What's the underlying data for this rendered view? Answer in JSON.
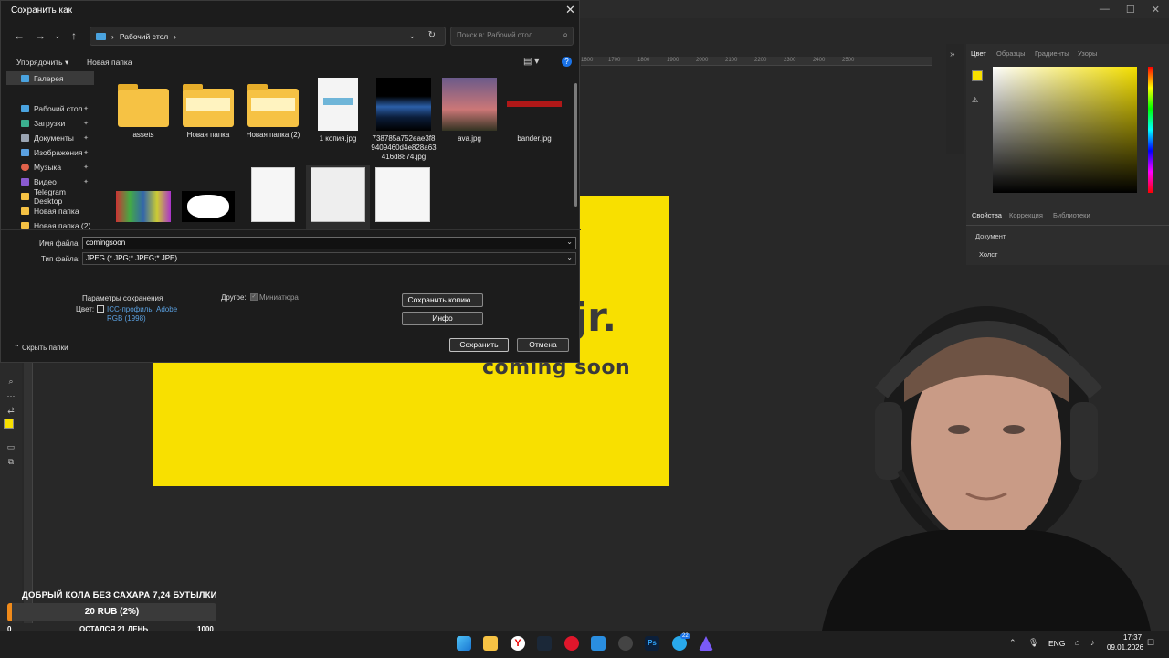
{
  "dialog": {
    "title": "Сохранить как",
    "address": "Рабочий стол",
    "search_placeholder": "Поиск в: Рабочий стол",
    "organize": "Упорядочить ▾",
    "new_folder": "Новая папка",
    "sidebar": [
      {
        "label": "Галерея",
        "color": "#4aa3df",
        "pinned": false
      },
      {
        "label": "Рабочий стол",
        "color": "#4aa3df",
        "pinned": true
      },
      {
        "label": "Загрузки",
        "color": "#3bb08f",
        "pinned": true
      },
      {
        "label": "Документы",
        "color": "#9aa4b2",
        "pinned": true
      },
      {
        "label": "Изображения",
        "color": "#5aa0e0",
        "pinned": true
      },
      {
        "label": "Музыка",
        "color": "#e0614a",
        "pinned": true
      },
      {
        "label": "Видео",
        "color": "#8a5ad0",
        "pinned": true
      },
      {
        "label": "Telegram Desktop",
        "color": "#f6c244",
        "pinned": false
      },
      {
        "label": "Новая папка",
        "color": "#f6c244",
        "pinned": false
      },
      {
        "label": "Новая папка (2)",
        "color": "#f6c244",
        "pinned": false
      }
    ],
    "files": [
      {
        "name": "assets",
        "kind": "folder"
      },
      {
        "name": "Новая папка",
        "kind": "folder"
      },
      {
        "name": "Новая папка (2)",
        "kind": "folder"
      },
      {
        "name": "1 копия.jpg",
        "kind": "image"
      },
      {
        "name": "738785a752eae3f89409460d4e828a63416d8874.jpg",
        "kind": "image"
      },
      {
        "name": "ava.jpg",
        "kind": "image"
      },
      {
        "name": "bander.jpg",
        "kind": "image"
      }
    ],
    "filename_label": "Имя файла:",
    "filename_value": "comingsoon",
    "filetype_label": "Тип файла:",
    "filetype_value": "JPEG (*.JPG;*.JPEG;*.JPE)",
    "save_options_title": "Параметры сохранения",
    "color_label": "Цвет:",
    "icc_label": "ICC-профиль: Adobe RGB (1998)",
    "other_label": "Другое:",
    "thumbnail_label": "Миниатюра",
    "save_copy_btn": "Сохранить копию...",
    "info_btn": "Инфо",
    "hide_folders": "Скрыть папки",
    "save_btn": "Сохранить",
    "cancel_btn": "Отмена"
  },
  "photoshop": {
    "panel_tabs": [
      "Цвет",
      "Образцы",
      "Градиенты",
      "Узоры"
    ],
    "props_tabs": [
      "Свойства",
      "Коррекция",
      "Библиотеки"
    ],
    "props_doc": "Документ",
    "props_canvas": "Холст",
    "canvas_text_jr": "jr.",
    "canvas_text_soon": "coming soon",
    "ruler_ticks": [
      "1600",
      "1700",
      "1800",
      "1900",
      "2000",
      "2100",
      "2200",
      "2300",
      "2400",
      "2500"
    ],
    "fg_color": "#f8e000"
  },
  "donation": {
    "title": "ДОБРЫЙ КОЛА БЕЗ САХАРА 7,24 БУТЫЛКИ",
    "amount": "20 RUB (2%)",
    "progress": 0.02,
    "min": "0",
    "left": "ОСТАЛСЯ 21 ДЕНЬ",
    "max": "1000"
  },
  "taskbar": {
    "lang": "ENG",
    "time": "17:37",
    "date": "09.01.2026",
    "telegram_badge": "22"
  }
}
